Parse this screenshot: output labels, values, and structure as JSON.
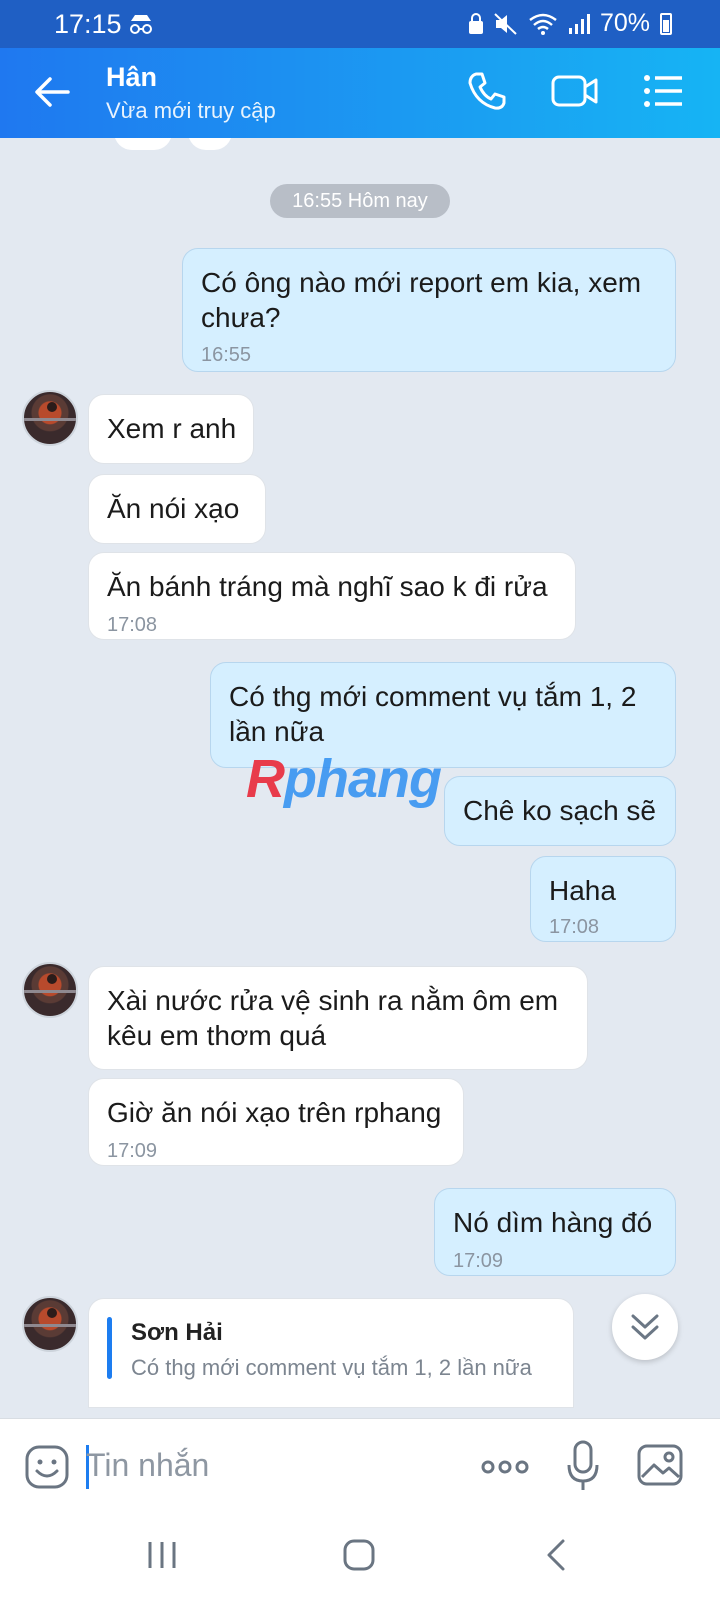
{
  "status_bar": {
    "time": "17:15",
    "battery": "70%"
  },
  "header": {
    "contact_name": "Hân",
    "presence": "Vừa mới truy cập"
  },
  "date_chip": "16:55 Hôm nay",
  "messages": [
    {
      "dir": "out",
      "text": "Có ông nào mới report em kia, xem chưa?",
      "time": "16:55"
    },
    {
      "dir": "in",
      "text": "Xem r anh"
    },
    {
      "dir": "in",
      "text": "Ăn nói xạo"
    },
    {
      "dir": "in",
      "text": "Ăn bánh tráng mà nghĩ sao k đi rửa",
      "time": "17:08"
    },
    {
      "dir": "out",
      "text": "Có thg mới comment vụ tắm 1, 2 lần nữa"
    },
    {
      "dir": "out",
      "text": "Chê ko sạch sẽ"
    },
    {
      "dir": "out",
      "text": "Haha",
      "time": "17:08"
    },
    {
      "dir": "in",
      "text": "Xài nước rửa vệ sinh ra nằm ôm em kêu em thơm quá"
    },
    {
      "dir": "in",
      "text": "Giờ ăn nói xạo trên rphang",
      "time": "17:09"
    },
    {
      "dir": "out",
      "text": "Nó dìm hàng đó",
      "time": "17:09"
    }
  ],
  "reply_preview": {
    "name": "Sơn Hải",
    "quoted": "Có thg mới comment vụ tắm 1, 2 lần nữa"
  },
  "watermark": {
    "part1": "R",
    "part2": "phang"
  },
  "input": {
    "placeholder": "Tin nhắn"
  },
  "icons": {
    "back": "back-arrow-icon",
    "call": "phone-icon",
    "video": "video-call-icon",
    "menu": "menu-list-icon",
    "emoji": "sticker-icon",
    "more": "more-dots-icon",
    "mic": "microphone-icon",
    "image": "image-icon",
    "scroll": "scroll-down-icon"
  },
  "colors": {
    "header_start": "#1f78f0",
    "header_end": "#16b4f4",
    "out_bubble": "#d5efff",
    "in_bubble": "#ffffff",
    "chat_bg": "#e3e9f1"
  }
}
